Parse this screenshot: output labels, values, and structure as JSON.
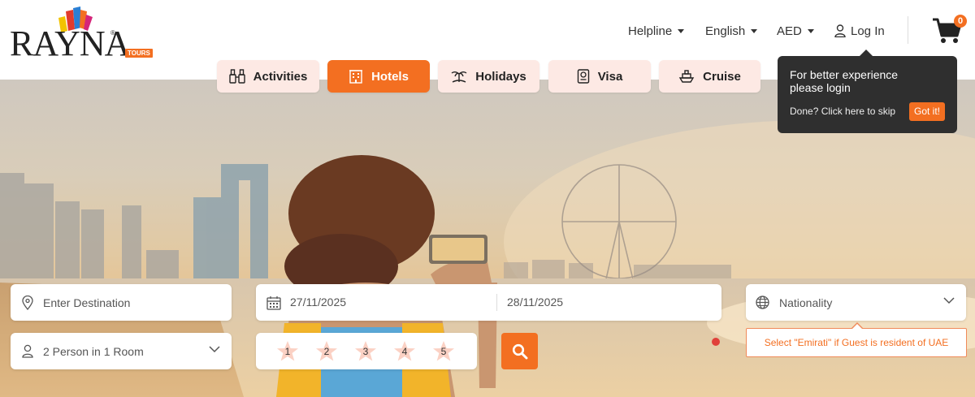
{
  "brand": {
    "logo_main": "RAYNA",
    "logo_badge": "TOURS",
    "logo_reg": "®"
  },
  "topnav": {
    "helpline": "Helpline",
    "language": "English",
    "currency": "AED",
    "login": "Log In",
    "cart_count": "0"
  },
  "tabs": [
    {
      "label": "Activities",
      "icon": "binoculars-icon",
      "active": false
    },
    {
      "label": "Hotels",
      "icon": "hotel-icon",
      "active": true
    },
    {
      "label": "Holidays",
      "icon": "island-icon",
      "active": false
    },
    {
      "label": "Visa",
      "icon": "passport-icon",
      "active": false
    },
    {
      "label": "Cruise",
      "icon": "ship-icon",
      "active": false
    }
  ],
  "login_tooltip": {
    "message": "For better experience please login",
    "skip_text": "Done? Click here to skip",
    "button": "Got it!"
  },
  "search": {
    "destination_placeholder": "Enter Destination",
    "checkin": "27/11/2025",
    "checkout": "28/11/2025",
    "nationality_placeholder": "Nationality",
    "nationality_hint": "Select \"Emirati\" if Guest is resident of UAE",
    "guests": "2 Person in 1 Room",
    "star_ratings": [
      "1",
      "2",
      "3",
      "4",
      "5"
    ]
  },
  "colors": {
    "accent": "#f36f21",
    "tab_bg": "#fde9e4",
    "tooltip_bg": "#2f2f2f"
  }
}
